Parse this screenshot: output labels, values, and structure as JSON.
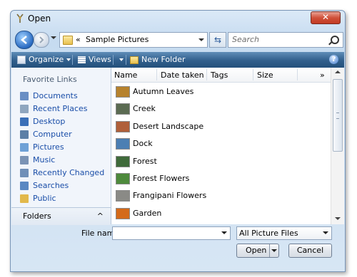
{
  "window": {
    "title": "Open",
    "close_symbol": "✕"
  },
  "address": {
    "chevrons": "«",
    "path": "Sample Pictures"
  },
  "search": {
    "placeholder": "Search"
  },
  "toolbar": {
    "organize_label": "Organize",
    "views_label": "Views",
    "new_folder_label": "New Folder",
    "help_symbol": "?"
  },
  "sidebar": {
    "heading": "Favorite Links",
    "items": [
      {
        "label": "Documents",
        "color": "#6a8fc4"
      },
      {
        "label": "Recent Places",
        "color": "#8fa6bf"
      },
      {
        "label": "Desktop",
        "color": "#3a6fb8"
      },
      {
        "label": "Computer",
        "color": "#5c7fa6"
      },
      {
        "label": "Pictures",
        "color": "#6ea1d6"
      },
      {
        "label": "Music",
        "color": "#7a93b5"
      },
      {
        "label": "Recently Changed",
        "color": "#6f8fb8"
      },
      {
        "label": "Searches",
        "color": "#5a88c2"
      },
      {
        "label": "Public",
        "color": "#e2b94b"
      }
    ],
    "folders_label": "Folders",
    "folders_chevron": "^"
  },
  "columns": {
    "name": "Name",
    "date_taken": "Date taken",
    "tags": "Tags",
    "size": "Size",
    "more": "»"
  },
  "files": [
    {
      "name": "Autumn Leaves",
      "thumb_color": "#b6822d"
    },
    {
      "name": "Creek",
      "thumb_color": "#5b6b52"
    },
    {
      "name": "Desert Landscape",
      "thumb_color": "#b0603a"
    },
    {
      "name": "Dock",
      "thumb_color": "#4c7fb3"
    },
    {
      "name": "Forest",
      "thumb_color": "#3f6a3a"
    },
    {
      "name": "Forest Flowers",
      "thumb_color": "#4e8a3c"
    },
    {
      "name": "Frangipani Flowers",
      "thumb_color": "#8a8a86"
    },
    {
      "name": "Garden",
      "thumb_color": "#d46a1a"
    }
  ],
  "bottom": {
    "filename_label": "File name:",
    "filename_value": "",
    "filter_value": "All Picture Files",
    "open_label": "Open",
    "cancel_label": "Cancel"
  }
}
